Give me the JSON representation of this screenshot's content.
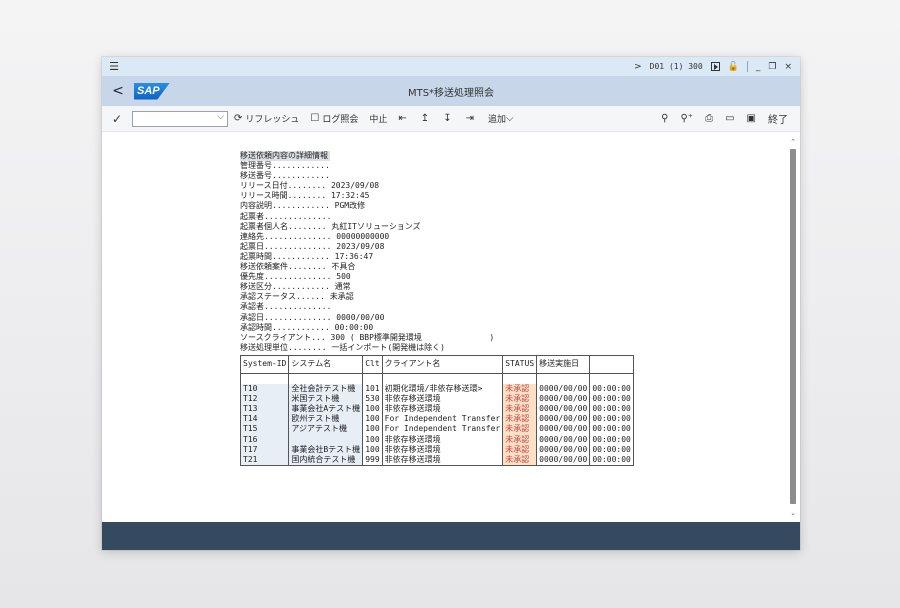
{
  "titlebar": {
    "nav": ">",
    "system": "D01 (1) 300",
    "buttons": [
      "_",
      "❐",
      "×"
    ]
  },
  "header": {
    "back": "<",
    "logo": "SAP",
    "title": "MTS*移送処理照会"
  },
  "toolbar": {
    "command_placeholder": "",
    "refresh": "リフレッシュ",
    "log": "ログ照会",
    "cancel": "中止",
    "add": "追加",
    "exit": "終了"
  },
  "report": {
    "heading": "移送依頼内容の詳細情報",
    "fields": [
      {
        "key": "管理番号............ ",
        "value": ""
      },
      {
        "key": "移送番号............ ",
        "value": ""
      },
      {
        "key": "リリース日付........ ",
        "value": "2023/09/08"
      },
      {
        "key": "リリース時間........ ",
        "value": "17:32:45"
      },
      {
        "key": "内容説明............ ",
        "value": "PGM改修"
      },
      {
        "key": "起票者.............. ",
        "value": ""
      },
      {
        "key": "起票者個人名........ ",
        "value": "丸紅ITソリューションズ"
      },
      {
        "key": "連絡先.............. ",
        "value": "00000000000"
      },
      {
        "key": "起票日.............. ",
        "value": "2023/09/08"
      },
      {
        "key": "起票時間............ ",
        "value": "17:36:47"
      },
      {
        "key": "移送依頼案件........ ",
        "value": "不具合"
      },
      {
        "key": "優先度.............. ",
        "value": "500"
      },
      {
        "key": "移送区分............ ",
        "value": "通常"
      },
      {
        "key": "承認ステータス...... ",
        "value": "未承認"
      },
      {
        "key": "承認者.............. ",
        "value": ""
      },
      {
        "key": "承認日.............. ",
        "value": "0000/00/00"
      },
      {
        "key": "承認時間............ ",
        "value": "00:00:00"
      },
      {
        "key": "ソースクライアント... ",
        "value": "300 ( BBP標準開発環境              )"
      },
      {
        "key": "移送処理単位........ ",
        "value": "一括インポート(開発機は除く)"
      }
    ],
    "table": {
      "headers": [
        "System-ID",
        "システム名",
        "Clt",
        "クライアント名",
        "STATUS",
        "移送実施日",
        ""
      ],
      "rows": [
        {
          "sys": "T10",
          "name": "全社会計テスト機",
          "clt": "101",
          "cname": "初期化環境/非依存移送環>",
          "status": "未承認",
          "date": "0000/00/00",
          "time": "00:00:00"
        },
        {
          "sys": "T12",
          "name": "米国テスト機",
          "clt": "530",
          "cname": "非依存移送環境",
          "status": "未承認",
          "date": "0000/00/00",
          "time": "00:00:00"
        },
        {
          "sys": "T13",
          "name": "事業会社Aテスト機",
          "clt": "100",
          "cname": "非依存移送環境",
          "status": "未承認",
          "date": "0000/00/00",
          "time": "00:00:00"
        },
        {
          "sys": "T14",
          "name": "欧州テスト機",
          "clt": "100",
          "cname": "For Independent Transfer",
          "status": "未承認",
          "date": "0000/00/00",
          "time": "00:00:00"
        },
        {
          "sys": "T15",
          "name": "アジアテスト機",
          "clt": "100",
          "cname": "For Independent Transfer",
          "status": "未承認",
          "date": "0000/00/00",
          "time": "00:00:00"
        },
        {
          "sys": "T16",
          "name": "",
          "clt": "100",
          "cname": "非依存移送環境",
          "status": "未承認",
          "date": "0000/00/00",
          "time": "00:00:00"
        },
        {
          "sys": "T17",
          "name": "事業会社Bテスト機",
          "clt": "100",
          "cname": "非依存移送環境",
          "status": "未承認",
          "date": "0000/00/00",
          "time": "00:00:00"
        },
        {
          "sys": "T21",
          "name": "国内統合テスト機",
          "clt": "999",
          "cname": "非依存移送環境",
          "status": "未承認",
          "date": "0000/00/00",
          "time": "00:00:00"
        }
      ]
    }
  }
}
